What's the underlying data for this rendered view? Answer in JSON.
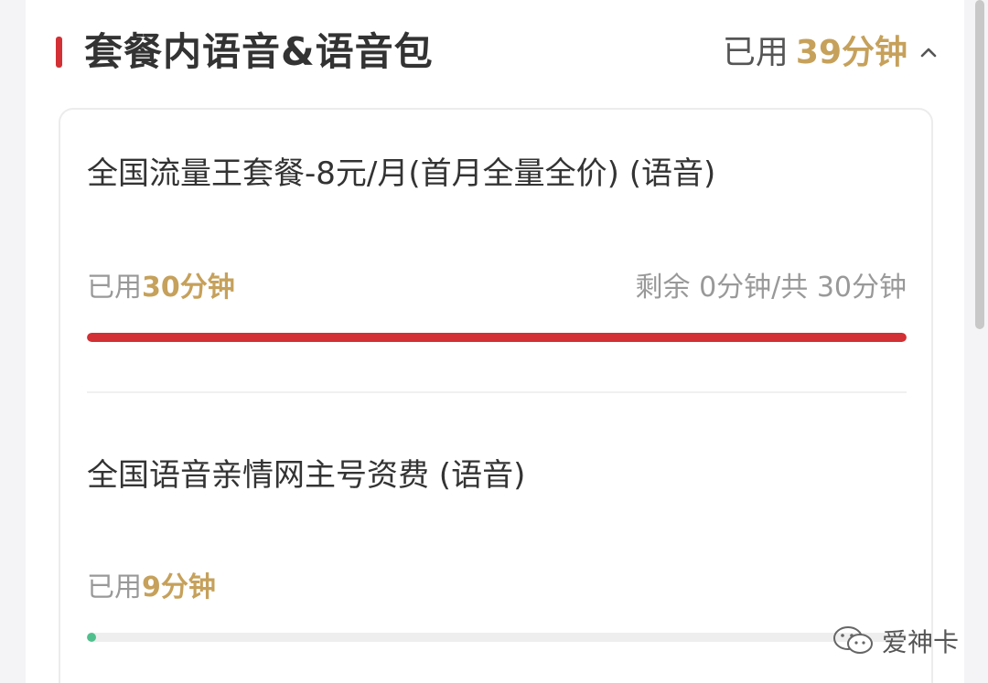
{
  "colors": {
    "accent_red": "#d23034",
    "gold": "#c6a15b",
    "green": "#4fc08d"
  },
  "header": {
    "title": "套餐内语音&语音包",
    "used_label": "已用",
    "used_amount": "39分钟",
    "chevron_icon": "chevron-up-icon"
  },
  "plans": [
    {
      "name": "全国流量王套餐-8元/月(首月全量全价) (语音)",
      "used_label": "已用",
      "used_value": "30分钟",
      "remain_text": "剩余 0分钟/共 30分钟",
      "progress_fraction": 1.0
    },
    {
      "name": "全国语音亲情网主号资费 (语音)",
      "used_label": "已用",
      "used_value": "9分钟",
      "remain_text": "",
      "progress_fraction": 0.01
    }
  ],
  "watermark": {
    "icon": "wechat-icon",
    "text": "爱神卡"
  }
}
